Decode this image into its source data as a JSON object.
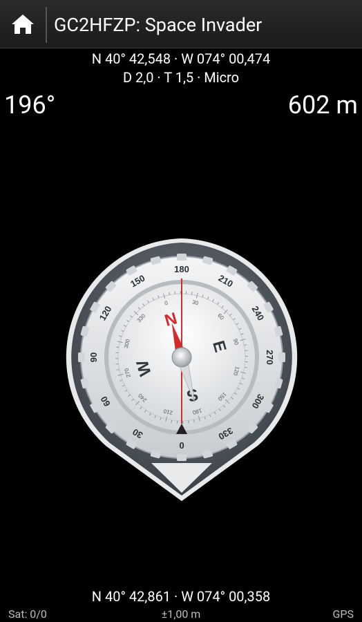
{
  "actionbar": {
    "title": "GC2HFZP: Space Invader",
    "home_icon": "home-icon"
  },
  "target": {
    "coords": "N 40° 42,548 · W 074° 00,474",
    "difficulty_terrain_size": "D 2,0 · T 1,5 · Micro"
  },
  "navigation": {
    "heading": "196°",
    "distance": "602 m"
  },
  "compass": {
    "outer_ticks": [
      "180",
      "210",
      "240",
      "270",
      "300",
      "330",
      "0",
      "30",
      "60",
      "90",
      "120",
      "150"
    ],
    "inner_ticks": [
      "0",
      "30",
      "60",
      "90",
      "120",
      "150",
      "180",
      "210",
      "240",
      "270",
      "300",
      "330"
    ],
    "cardinals": [
      "N",
      "E",
      "S",
      "W"
    ],
    "accent_needle": "#d22b2b"
  },
  "current": {
    "coords": "N 40° 42,861 · W 074° 00,358"
  },
  "status": {
    "satellites": "Sat: 0/0",
    "accuracy": "±1,00 m",
    "provider": "GPS"
  }
}
